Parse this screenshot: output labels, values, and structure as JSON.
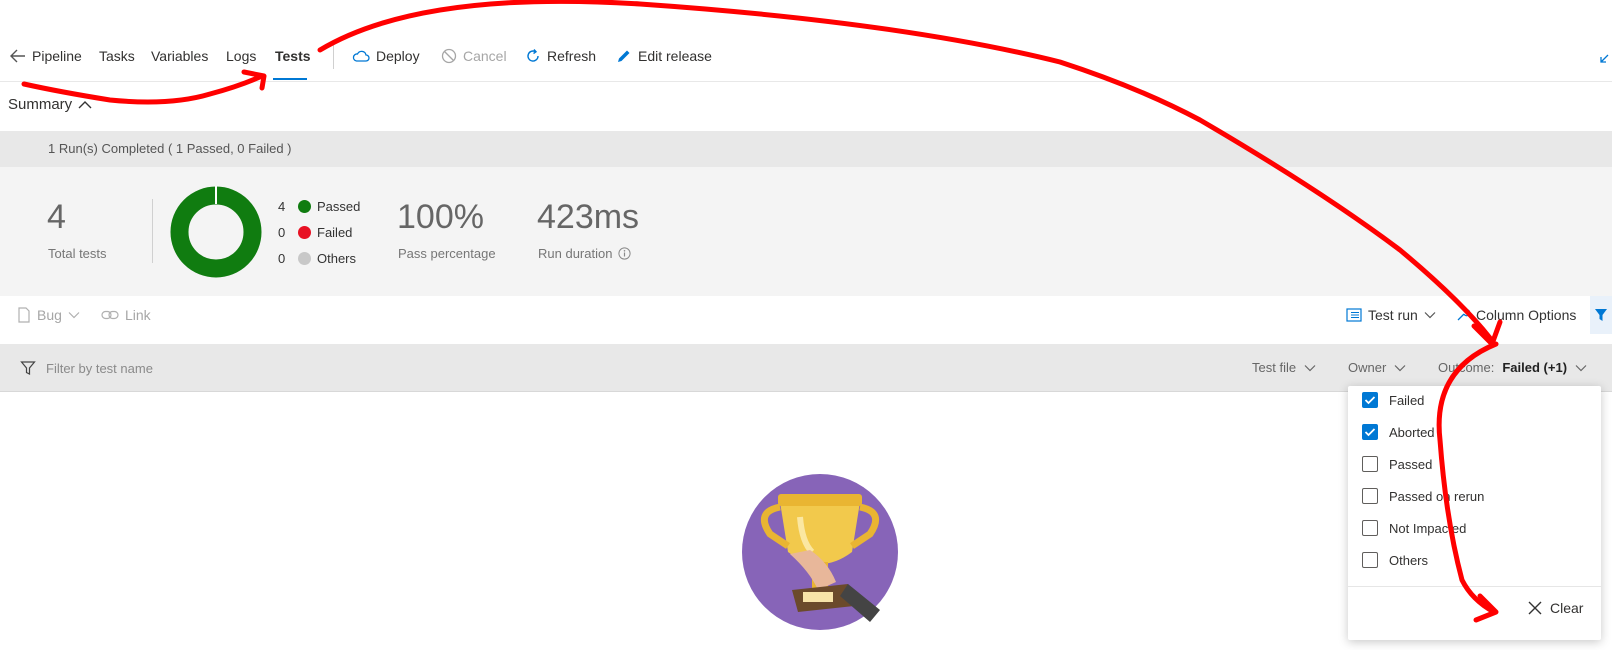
{
  "nav": {
    "back_label": "Pipeline",
    "tabs": [
      "Tasks",
      "Variables",
      "Logs",
      "Tests"
    ],
    "active_tab": "Tests",
    "actions": {
      "deploy": "Deploy",
      "cancel": "Cancel",
      "refresh": "Refresh",
      "edit_release": "Edit release"
    }
  },
  "summary": {
    "title": "Summary",
    "runs_text": "1 Run(s) Completed ( 1 Passed, 0 Failed )",
    "total_tests_value": "4",
    "total_tests_label": "Total tests",
    "legend": [
      {
        "count": "4",
        "label": "Passed",
        "color": "#107c10"
      },
      {
        "count": "0",
        "label": "Failed",
        "color": "#e81123"
      },
      {
        "count": "0",
        "label": "Others",
        "color": "#c8c8c8"
      }
    ],
    "pass_pct_value": "100%",
    "pass_pct_label": "Pass percentage",
    "duration_value": "423ms",
    "duration_label": "Run duration"
  },
  "toolbar": {
    "bug": "Bug",
    "link": "Link",
    "test_run": "Test run",
    "column_options": "Column Options"
  },
  "filters": {
    "placeholder": "Filter by test name",
    "test_file": "Test file",
    "owner": "Owner",
    "outcome_label": "Outcome:",
    "outcome_value": "Failed (+1)"
  },
  "outcome_dropdown": {
    "options": [
      {
        "label": "Failed",
        "checked": true
      },
      {
        "label": "Aborted",
        "checked": true
      },
      {
        "label": "Passed",
        "checked": false
      },
      {
        "label": "Passed on rerun",
        "checked": false
      },
      {
        "label": "Not Impacted",
        "checked": false
      },
      {
        "label": "Others",
        "checked": false
      }
    ],
    "clear": "Clear"
  },
  "colors": {
    "accent": "#0078d4",
    "passed": "#107c10",
    "annotation": "#ff0000"
  }
}
